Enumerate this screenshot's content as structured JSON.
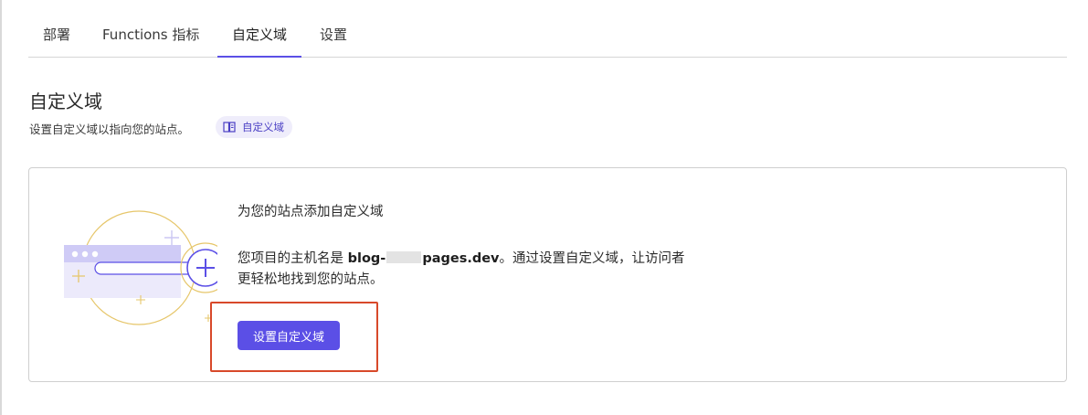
{
  "tabs": [
    {
      "label": "部署"
    },
    {
      "label": "Functions 指标"
    },
    {
      "label": "自定义域"
    },
    {
      "label": "设置"
    }
  ],
  "active_tab": "自定义域",
  "section": {
    "title": "自定义域",
    "subtitle": "设置自定义域以指向您的站点。",
    "doc_badge_label": "自定义域"
  },
  "card": {
    "title": "为您的站点添加自定义域",
    "desc_prefix": "您项目的主机名是 ",
    "host_start": "blog-",
    "host_end": "pages.dev",
    "desc_suffix": "。通过设置自定义域，让访问者",
    "desc_line2": "更轻松地找到您的站点。",
    "button_label": "设置自定义域"
  },
  "colors": {
    "accent": "#5b4fe6",
    "highlight": "#d8492a",
    "badge_bg": "#efedfb"
  }
}
